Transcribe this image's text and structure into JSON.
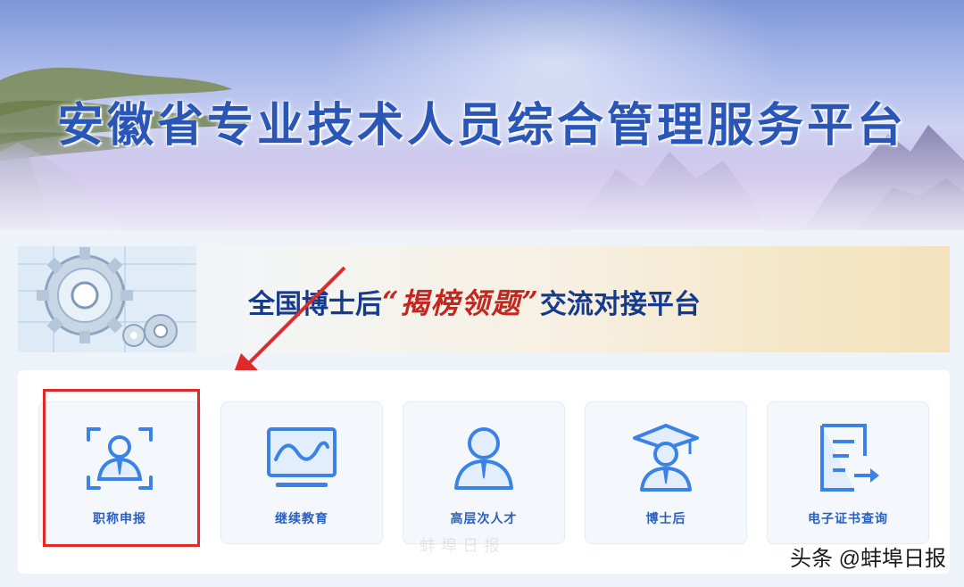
{
  "header": {
    "title": "安徽省专业技术人员综合管理服务平台"
  },
  "promo": {
    "prefix": "全国博士后",
    "quote_open": "“",
    "calligraphy": "揭榜领题",
    "quote_close": "”",
    "suffix": "交流对接平台"
  },
  "services": [
    {
      "label": "职称申报",
      "icon": "person-scan-icon"
    },
    {
      "label": "继续教育",
      "icon": "monitor-wave-icon"
    },
    {
      "label": "高层次人才",
      "icon": "person-icon"
    },
    {
      "label": "博士后",
      "icon": "graduate-icon"
    },
    {
      "label": "电子证书查询",
      "icon": "document-export-icon"
    }
  ],
  "watermark": "头条 @蚌埠日报",
  "faint_stamp": "蚌埠日报",
  "colors": {
    "accent": "#2b5fbf",
    "icon_blue": "#3b82e6",
    "highlight_red": "#e02a2a"
  }
}
